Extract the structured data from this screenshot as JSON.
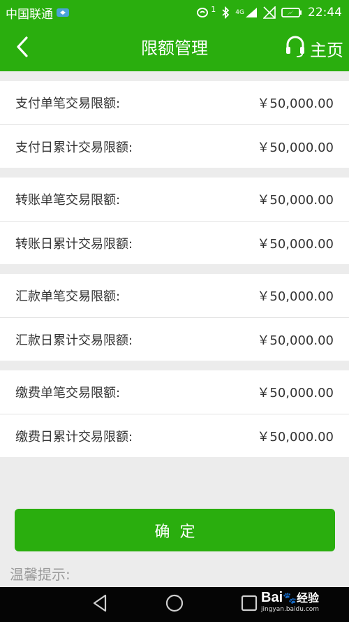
{
  "status_bar": {
    "carrier": "中国联通",
    "time": "22:44",
    "signal_superscript": "1",
    "network_label": "4G",
    "icons": [
      "carrier-badge-icon",
      "hd-call-icon",
      "bluetooth-icon",
      "signal-icon",
      "no-sim-icon",
      "battery-charging-icon"
    ]
  },
  "header": {
    "title": "限额管理",
    "back_icon": "chevron-left-icon",
    "home_label": "主页",
    "home_icon": "headset-icon"
  },
  "limit_groups": [
    {
      "rows": [
        {
          "label": "支付单笔交易限额:",
          "value": "￥50,000.00"
        },
        {
          "label": "支付日累计交易限额:",
          "value": "￥50,000.00"
        }
      ]
    },
    {
      "rows": [
        {
          "label": "转账单笔交易限额:",
          "value": "￥50,000.00"
        },
        {
          "label": "转账日累计交易限额:",
          "value": "￥50,000.00"
        }
      ]
    },
    {
      "rows": [
        {
          "label": "汇款单笔交易限额:",
          "value": "￥50,000.00"
        },
        {
          "label": "汇款日累计交易限额:",
          "value": "￥50,000.00"
        }
      ]
    },
    {
      "rows": [
        {
          "label": "缴费单笔交易限额:",
          "value": "￥50,000.00"
        },
        {
          "label": "缴费日累计交易限额:",
          "value": "￥50,000.00"
        }
      ]
    }
  ],
  "confirm_button": "确定",
  "tip_title": "温馨提示:",
  "system_nav": [
    "back-triangle-icon",
    "home-circle-icon",
    "recents-square-icon"
  ],
  "watermark": {
    "brand": "Bai",
    "brand_suffix": "经验",
    "url": "jingyan.baidu.com"
  },
  "colors": {
    "primary": "#2aae0e",
    "background": "#ececec",
    "row_background": "#ffffff",
    "text": "#333333",
    "tip_text": "#9a9a9a"
  }
}
